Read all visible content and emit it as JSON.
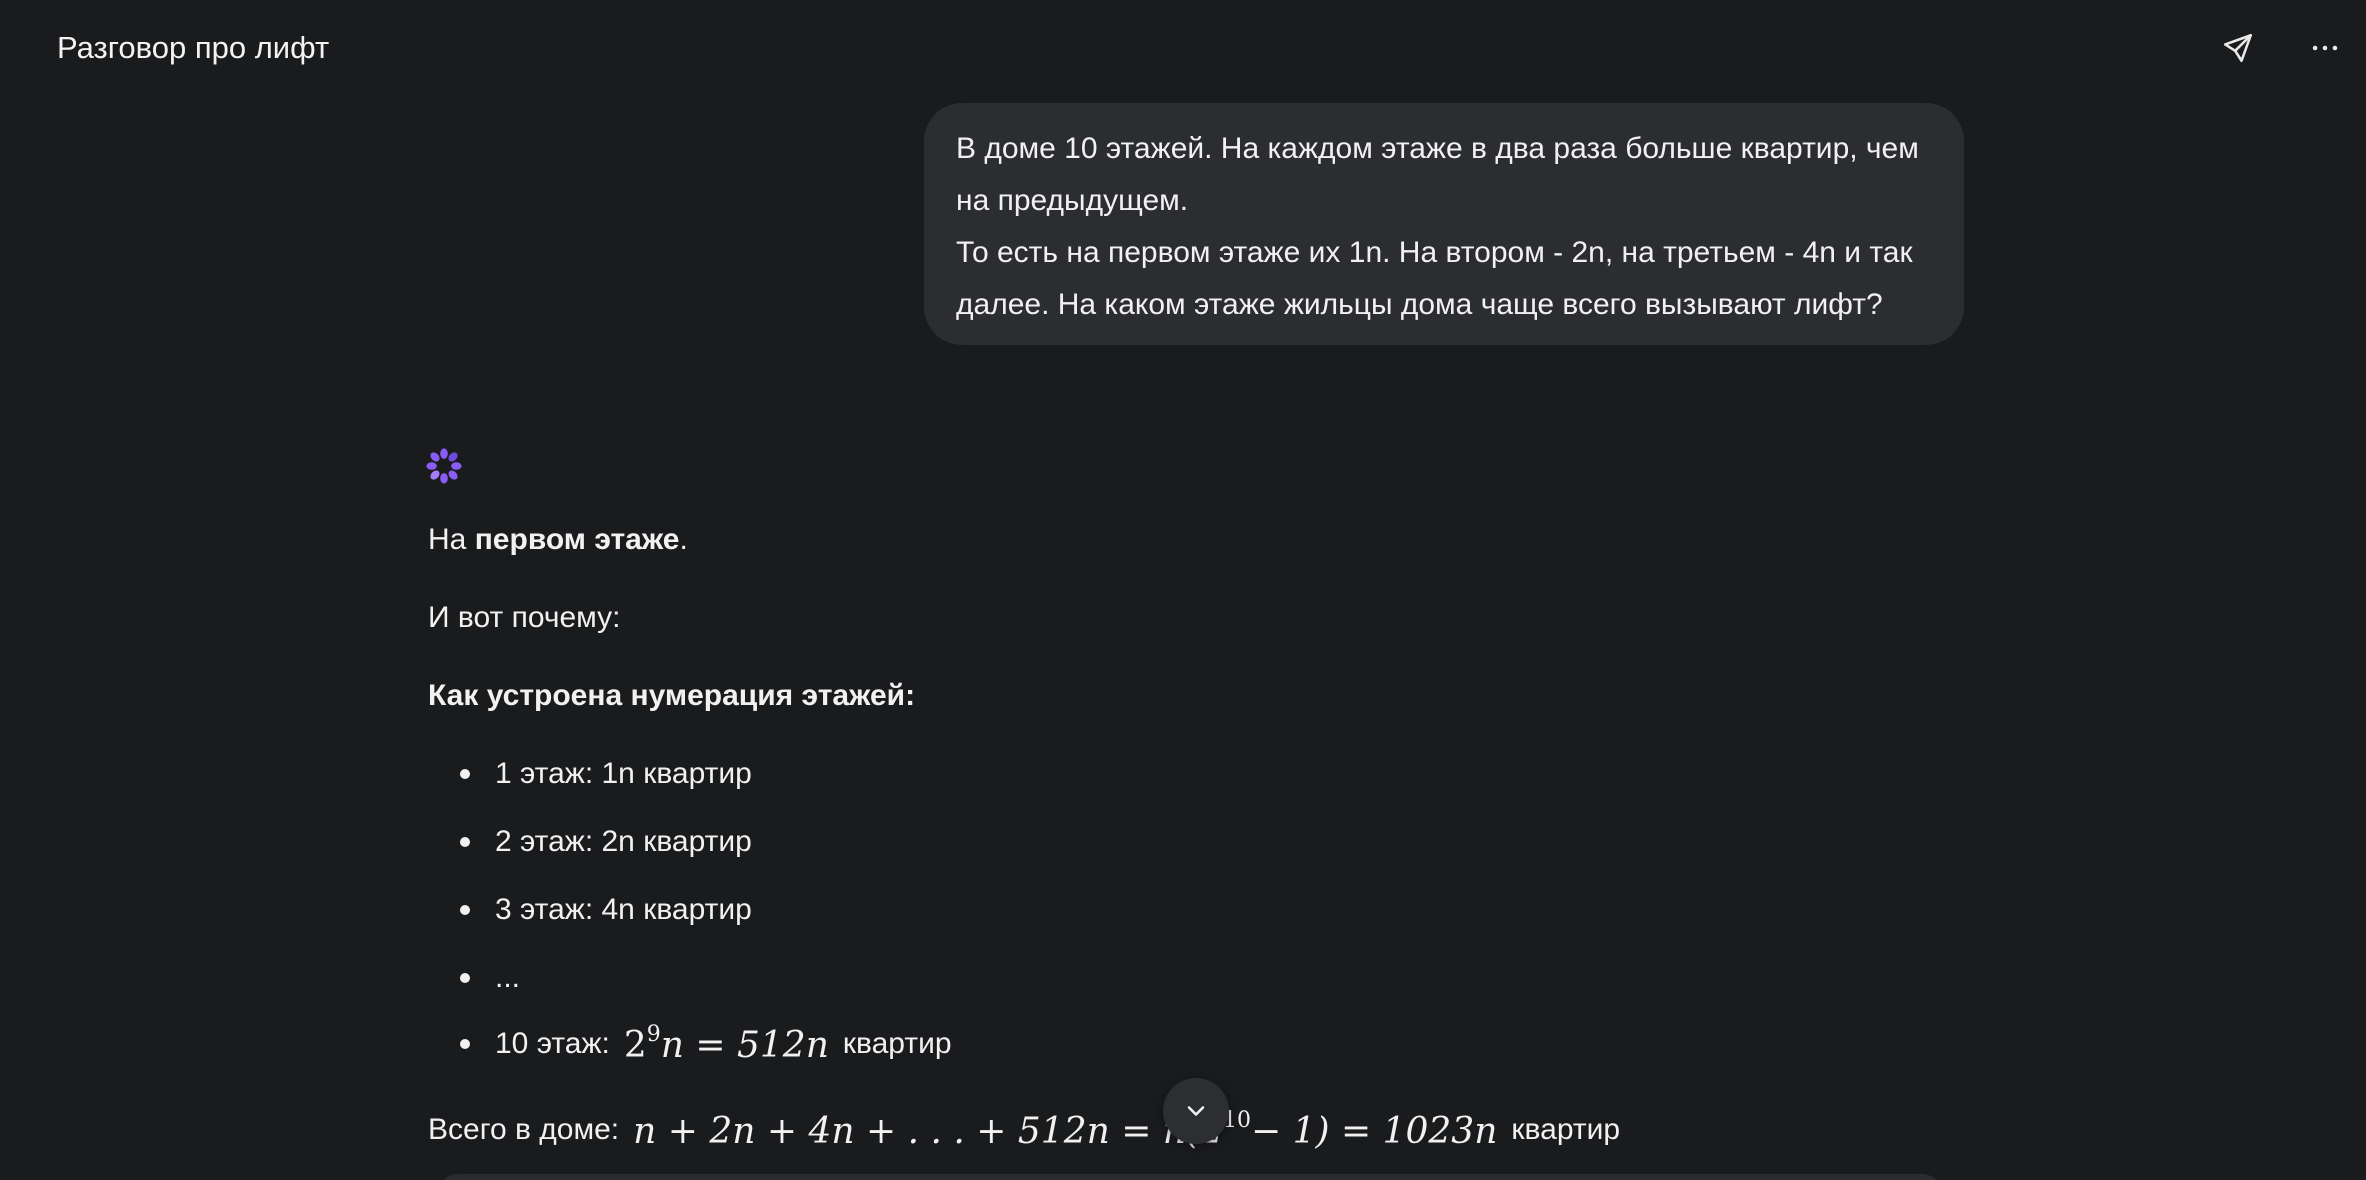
{
  "header": {
    "title": "Разговор про лифт",
    "share_icon": "send-icon",
    "more_icon": "more-horizontal-icon"
  },
  "user_message": {
    "lines": [
      "В доме 10 этажей. На каждом этаже в два раза больше квартир, чем",
      "на предыдущем.",
      "То есть на первом этаже их 1n. На втором - 2n, на третьем - 4n и так",
      "далее. На каком этаже жильцы дома чаще всего вызывают лифт?"
    ]
  },
  "assistant": {
    "icon": "assistant-logo-icon",
    "answer_prefix": "На ",
    "answer_bold": "первом этаже",
    "answer_suffix": ".",
    "reason": "И вот почему:",
    "section_heading": "Как устроена нумерация этажей:",
    "list": [
      "1 этаж: 1n квартир",
      "2 этаж: 2n квартир",
      "3 этаж: 4n квартир",
      "...",
      "10 этаж:"
    ],
    "list_last_math": {
      "base": "2",
      "exp": "9",
      "rest": "n = 512n"
    },
    "list_last_suffix": "квартир",
    "total_prefix": "Всего в доме:",
    "total_math": "n + 2n + 4n + . . . + 512n = n(2",
    "total_math_exp": "10",
    "total_math_rest": "− 1) = 1023n",
    "total_suffix": "квартир"
  },
  "colors": {
    "background": "#1a1b1d",
    "bubble": "#2b2d30",
    "text": "#f1f1f2",
    "accent": "#8a5cf6"
  }
}
